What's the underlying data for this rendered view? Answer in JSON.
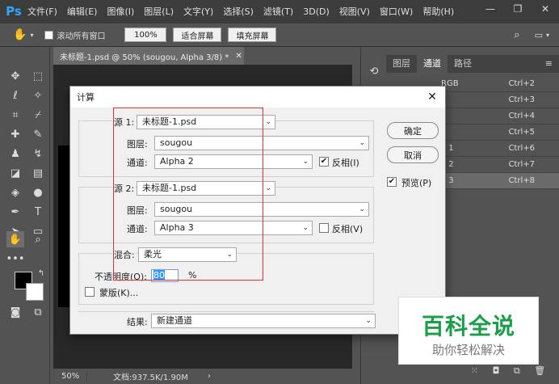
{
  "app": {
    "logo": "Ps"
  },
  "menu": [
    "文件(F)",
    "编辑(E)",
    "图像(I)",
    "图层(L)",
    "文字(Y)",
    "选择(S)",
    "滤镜(T)",
    "3D(D)",
    "视图(V)",
    "窗口(W)",
    "帮助(H)"
  ],
  "window_controls": {
    "minimize": "—",
    "maximize": "❐",
    "close": "✕"
  },
  "options": {
    "scroll_all": "滚动所有窗口",
    "zoom": "100%",
    "fit_screen": "适合屏幕",
    "fill_screen": "填充屏幕"
  },
  "document": {
    "tab_title": "未标题-1.psd @ 50% (sougou, Alpha 3/8) *",
    "zoom": "50%",
    "doc_info": "文档:937.5K/1.90M"
  },
  "panels": {
    "tabs": [
      "图层",
      "通道",
      "路径"
    ],
    "channels": [
      {
        "name": "RGB",
        "key": "Ctrl+2"
      },
      {
        "name": "",
        "key": "Ctrl+3"
      },
      {
        "name": "",
        "key": "Ctrl+4"
      },
      {
        "name": "",
        "key": "Ctrl+5"
      },
      {
        "name": "a 1",
        "key": "Ctrl+6"
      },
      {
        "name": "a 2",
        "key": "Ctrl+7"
      },
      {
        "name": "a 3",
        "key": "Ctrl+8"
      }
    ]
  },
  "dialog": {
    "title": "计算",
    "source1": {
      "label": "源 1:",
      "file": "未标题-1.psd",
      "layer_label": "图层:",
      "layer": "sougou",
      "channel_label": "通道:",
      "channel": "Alpha 2",
      "invert_label": "反相(I)",
      "invert": true
    },
    "source2": {
      "label": "源 2:",
      "file": "未标题-1.psd",
      "layer_label": "图层:",
      "layer": "sougou",
      "channel_label": "通道:",
      "channel": "Alpha 3",
      "invert_label": "反相(V)",
      "invert": false
    },
    "blend": {
      "label": "混合:",
      "mode": "柔光",
      "opacity_label": "不透明度(O):",
      "opacity": "80",
      "percent": "%",
      "mask_label": "蒙版(K)..."
    },
    "result": {
      "label": "结果:",
      "value": "新建通道"
    },
    "ok": "确定",
    "cancel": "取消",
    "preview_label": "预览(P)",
    "preview": true
  },
  "watermark": {
    "title": "百科全说",
    "subtitle": "助你轻松解决"
  }
}
